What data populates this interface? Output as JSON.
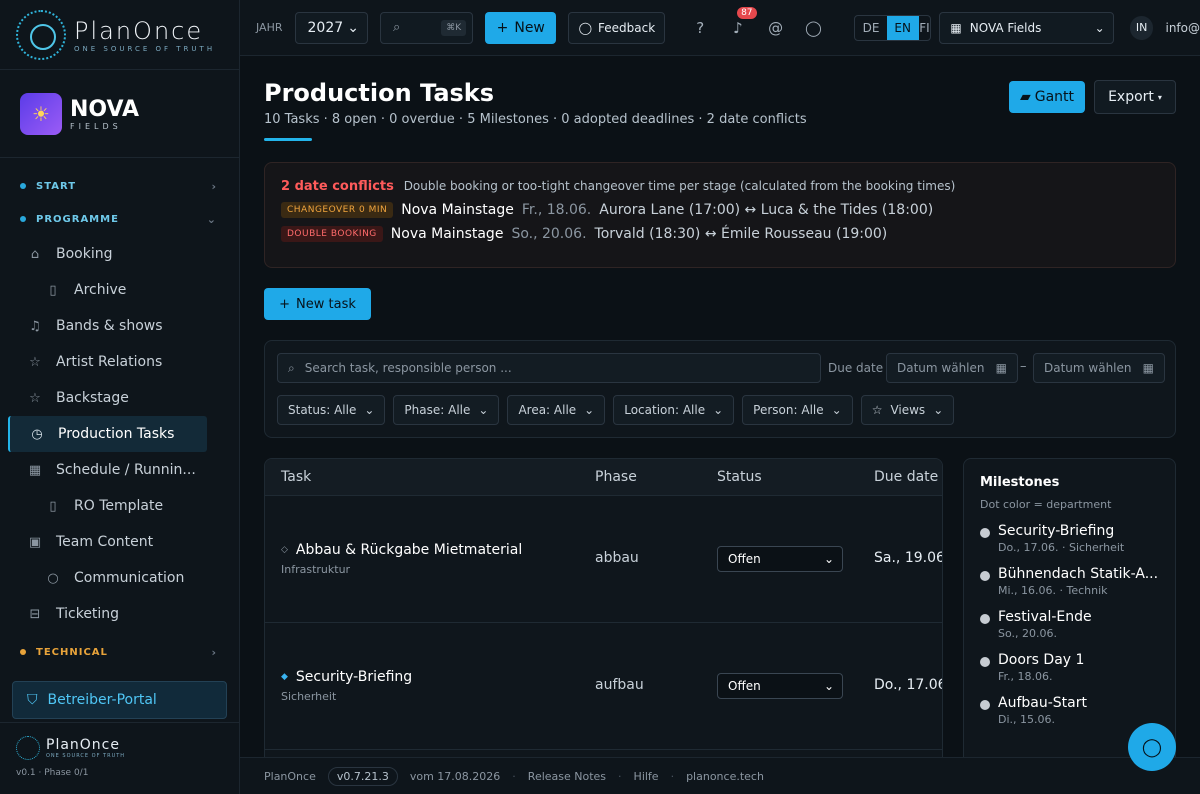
{
  "app": {
    "logo_title": "PlanOnce",
    "logo_tagline": "ONE SOURCE OF TRUTH",
    "brand_name": "NOVA",
    "brand_sub": "FIELDS"
  },
  "sidebar": {
    "sections": {
      "start": "START",
      "programme": "PROGRAMME",
      "technical": "TECHNICAL"
    },
    "items": [
      {
        "label": "Booking",
        "icon": "tag-icon"
      },
      {
        "label": "Archive",
        "icon": "file-icon"
      },
      {
        "label": "Bands & shows",
        "icon": "music-icon"
      },
      {
        "label": "Artist Relations",
        "icon": "star-icon"
      },
      {
        "label": "Backstage",
        "icon": "star-icon"
      },
      {
        "label": "Production Tasks",
        "icon": "clock-icon"
      },
      {
        "label": "Schedule / Runnin...",
        "icon": "calendar-icon"
      },
      {
        "label": "RO Template",
        "icon": "file-icon"
      },
      {
        "label": "Team Content",
        "icon": "image-icon"
      },
      {
        "label": "Communication",
        "icon": "chat-icon"
      },
      {
        "label": "Ticketing",
        "icon": "ticket-icon"
      }
    ],
    "portal_label": "Betreiber-Portal",
    "footer_title": "PlanOnce",
    "footer_tagline": "ONE SOURCE OF TRUTH",
    "version": "v0.1 · Phase 0/1"
  },
  "topbar": {
    "year_label": "JAHR",
    "year_value": "2027",
    "search_kbd": "⌘K",
    "new_label": "New",
    "feedback_label": "Feedback",
    "notif_count": "87",
    "languages": [
      "DE",
      "EN",
      "FI"
    ],
    "active_language": "EN",
    "festival_select": "NOVA Fields",
    "avatar_initials": "IN",
    "user_email": "info@"
  },
  "page": {
    "title": "Production Tasks",
    "stats": "10 Tasks · 8 open · 0 overdue · 5 Milestones · 0 adopted deadlines · 2 date conflicts",
    "gantt_label": "Gantt",
    "export_label": "Export"
  },
  "conflicts": {
    "heading": "2 date conflicts",
    "description": "Double booking or too-tight changeover time per stage (calculated from the booking times)",
    "rows": [
      {
        "tag": "CHANGEOVER 0 MIN",
        "stage": "Nova Mainstage",
        "date": "Fr., 18.06.",
        "text": "Aurora Lane (17:00) ↔ Luca & the Tides (18:00)"
      },
      {
        "tag": "DOUBLE BOOKING",
        "stage": "Nova Mainstage",
        "date": "So., 20.06.",
        "text": "Torvald (18:30) ↔ Émile Rousseau (19:00)"
      }
    ]
  },
  "new_task_label": "New task",
  "filters": {
    "search_placeholder": "Search task, responsible person ...",
    "due_label": "Due date",
    "date_placeholder": "Datum wählen",
    "dash": "–",
    "chips": [
      "Status: Alle",
      "Phase: Alle",
      "Area: Alle",
      "Location: Alle",
      "Person: Alle",
      "Views"
    ]
  },
  "table": {
    "headers": [
      "Task",
      "Phase",
      "Status",
      "Due date"
    ],
    "rows": [
      {
        "name": "Abbau & Rückgabe Mietmaterial",
        "dept": "Infrastruktur",
        "phase": "abbau",
        "status": "Offen",
        "due": "Sa., 19.06.",
        "marker": "◇"
      },
      {
        "name": "Security-Briefing",
        "dept": "Sicherheit",
        "phase": "aufbau",
        "status": "Offen",
        "due": "Do., 17.06.",
        "marker": "◆"
      }
    ]
  },
  "milestones": {
    "title": "Milestones",
    "subtitle": "Dot color = department",
    "items": [
      {
        "name": "Security-Briefing",
        "meta": "Do., 17.06. · Sicherheit"
      },
      {
        "name": "Bühnendach Statik-A...",
        "meta": "Mi., 16.06. · Technik"
      },
      {
        "name": "Festival-Ende",
        "meta": "So., 20.06."
      },
      {
        "name": "Doors Day 1",
        "meta": "Fr., 18.06."
      },
      {
        "name": "Aufbau-Start",
        "meta": "Di., 15.06."
      }
    ]
  },
  "bottombar": {
    "app": "PlanOnce",
    "version": "v0.7.21.3",
    "date": "vom 17.08.2026",
    "release_notes": "Release Notes",
    "help": "Hilfe",
    "site": "planonce.tech"
  },
  "colors": {
    "accent": "#1fa9e8",
    "danger": "#ff5b5b",
    "warning": "#f0a43d"
  }
}
